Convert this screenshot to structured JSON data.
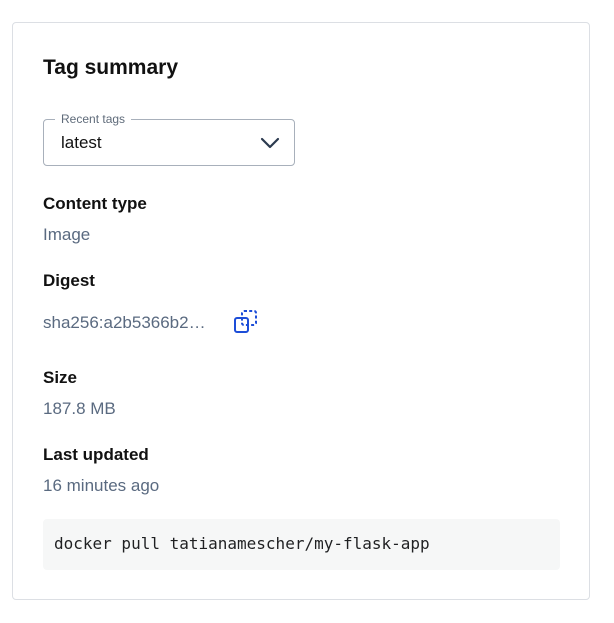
{
  "summary": {
    "title": "Tag summary",
    "recent_tags": {
      "label": "Recent tags",
      "selected": "latest",
      "icon": "chevron-down-icon"
    },
    "content_type": {
      "label": "Content type",
      "value": "Image"
    },
    "digest": {
      "label": "Digest",
      "value": "sha256:a2b5366b2…",
      "copy_icon": "copy-icon"
    },
    "size": {
      "label": "Size",
      "value": "187.8 MB"
    },
    "last_updated": {
      "label": "Last updated",
      "value": "16 minutes ago"
    },
    "pull_command": "docker pull tatianamescher/my-flask-app"
  },
  "colors": {
    "accent": "#1d4ed8",
    "muted_text": "#5a6a80",
    "border": "#dcdfe4",
    "code_bg": "#f6f7f7"
  }
}
